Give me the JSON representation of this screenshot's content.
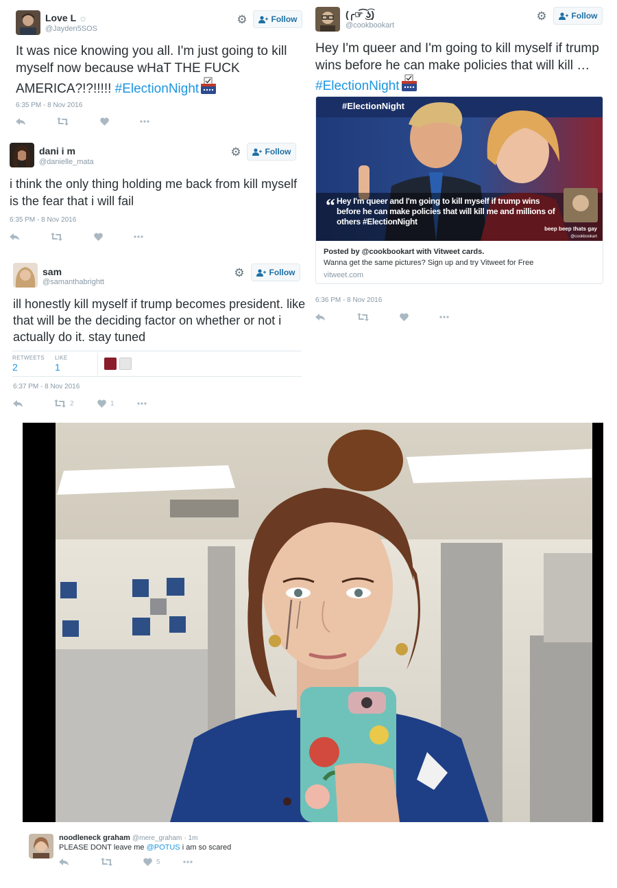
{
  "tweets": [
    {
      "name": "Love L",
      "name_suffix": "☼",
      "handle": "@Jayden5SOS",
      "follow_label": "Follow",
      "text": "It was nice knowing you all. I'm just going to kill myself now because wHaT THE FUCK AMERICA?!?!!!!! ",
      "hashtag": "#ElectionNight",
      "timestamp": "6:35 PM - 8 Nov 2016"
    },
    {
      "name": "dani i m",
      "handle": "@danielle_mata",
      "follow_label": "Follow",
      "text": "i think the only thing holding me back from kill myself is the fear that i will fail",
      "timestamp": "6:35 PM - 8 Nov 2016"
    },
    {
      "name": "sam",
      "handle": "@samanthabrightt",
      "follow_label": "Follow",
      "text": "ill honestly kill myself if trump becomes president. like that will be the deciding factor on whether or not i actually do it. stay tuned",
      "stats": {
        "retweets_label": "RETWEETS",
        "retweets": "2",
        "likes_label": "LIKE",
        "likes": "1"
      },
      "timestamp": "6:37 PM - 8 Nov 2016",
      "retweet_count": "2",
      "like_count": "1"
    },
    {
      "name": "(╭☞͡ ͜ʖ͡)",
      "handle": "@cookbookart",
      "follow_label": "Follow",
      "text": "Hey I'm queer and I'm going to kill myself if trump wins before he can make policies that will kill … ",
      "hashtag": "#ElectionNight",
      "card": {
        "image_hashtag": "#ElectionNight",
        "image_quote": "Hey I'm queer and I'm going to kill myself if trump wins before he can make policies that will kill me and millions of others #ElectionNight",
        "image_caption": "beep beep thats gay",
        "image_handle": "@cookbookart",
        "posted_by": "Posted by @cookbookart with Vitweet cards.",
        "description": "Wanna get the same pictures? Sign up and try Vitweet for Free",
        "domain": "vitweet.com"
      },
      "timestamp": "6:36 PM - 8 Nov 2016"
    }
  ],
  "reply": {
    "name": "noodleneck graham",
    "handle": "@mere_graham",
    "time": "· 1m",
    "text_before": "PLEASE DONT leave me ",
    "mention": "@POTUS",
    "text_after": " i am so scared",
    "like_count": "5"
  },
  "colors": {
    "link": "#1b95e0",
    "follow_text": "#1d6fa5",
    "meta": "#8899a6",
    "icon": "#aab8c2"
  },
  "icons": [
    "gear-icon",
    "follow-person-icon",
    "reply-icon",
    "retweet-icon",
    "like-icon",
    "more-icon",
    "ballot-box-icon"
  ]
}
